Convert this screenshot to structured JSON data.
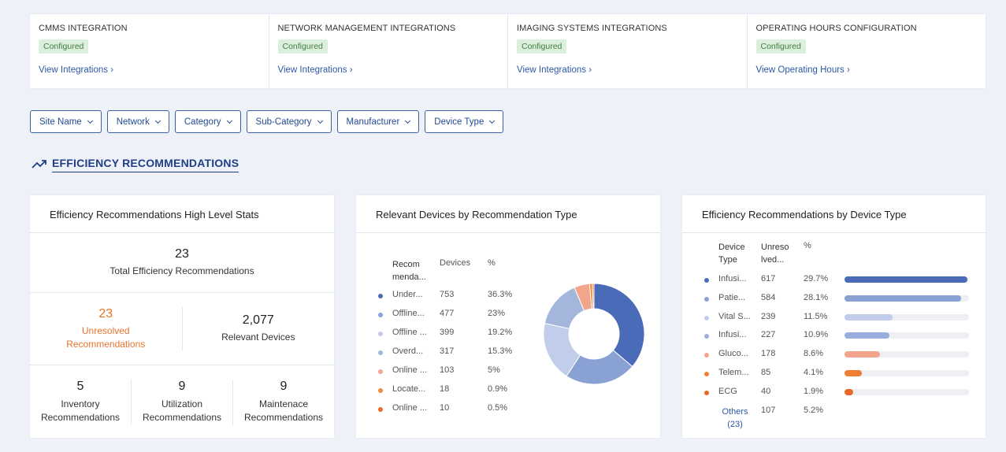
{
  "integrations": [
    {
      "title": "CMMS INTEGRATION",
      "status": "Configured",
      "link": "View Integrations ›"
    },
    {
      "title": "NETWORK MANAGEMENT INTEGRATIONS",
      "status": "Configured",
      "link": "View Integrations ›"
    },
    {
      "title": "IMAGING SYSTEMS INTEGRATIONS",
      "status": "Configured",
      "link": "View Integrations ›"
    },
    {
      "title": "OPERATING HOURS CONFIGURATION",
      "status": "Configured",
      "link": "View Operating Hours ›"
    }
  ],
  "filters": [
    "Site Name",
    "Network",
    "Category",
    "Sub-Category",
    "Manufacturer",
    "Device Type"
  ],
  "section": {
    "title": "EFFICIENCY RECOMMENDATIONS",
    "icon": "trending-up-icon"
  },
  "stats_card": {
    "title": "Efficiency Recommendations High Level Stats",
    "total_value": "23",
    "total_label": "Total Efficiency Recommendations",
    "unresolved_value": "23",
    "unresolved_label_1": "Unresolved",
    "unresolved_label_2": "Recommendations",
    "devices_value": "2,077",
    "devices_label": "Relevant Devices",
    "inventory_value": "5",
    "inventory_label_1": "Inventory",
    "inventory_label_2": "Recommendations",
    "utilization_value": "9",
    "utilization_label_1": "Utilization",
    "utilization_label_2": "Recommendations",
    "maintenance_value": "9",
    "maintenance_label_1": "Maintenace",
    "maintenance_label_2": "Recommendations"
  },
  "rec_card": {
    "title": "Relevant Devices by Recommendation Type",
    "headers": {
      "rec_1": "Recom",
      "rec_2": "menda...",
      "devices": "Devices",
      "pct": "%"
    },
    "rows": [
      {
        "label": "Under...",
        "devices": "753",
        "pct": "36.3%",
        "color": "#4a6cb8",
        "value": 36.3
      },
      {
        "label": "Offline...",
        "devices": "477",
        "pct": "23%",
        "color": "#8aa1d4",
        "value": 23
      },
      {
        "label": "Offline ...",
        "devices": "399",
        "pct": "19.2%",
        "color": "#c1cdea",
        "value": 19.2
      },
      {
        "label": "Overd...",
        "devices": "317",
        "pct": "15.3%",
        "color": "#a5b6dd",
        "value": 15.3
      },
      {
        "label": "Online ...",
        "devices": "103",
        "pct": "5%",
        "color": "#f0a58c",
        "value": 5
      },
      {
        "label": "Locate...",
        "devices": "18",
        "pct": "0.9%",
        "color": "#ee8a3a",
        "value": 0.9
      },
      {
        "label": "Online ...",
        "devices": "10",
        "pct": "0.5%",
        "color": "#e56a28",
        "value": 0.5
      }
    ]
  },
  "device_card": {
    "title": "Efficiency Recommendations by Device Type",
    "headers": {
      "type_1": "Device",
      "type_2": "Type",
      "unres_1": "Unreso",
      "unres_2": "lved...",
      "pct": "%"
    },
    "rows": [
      {
        "label": "Infusi...",
        "count": "617",
        "pct": "29.7%",
        "color": "#4a6cb8",
        "value": 29.7
      },
      {
        "label": "Patie...",
        "count": "584",
        "pct": "28.1%",
        "color": "#8aa1d4",
        "value": 28.1
      },
      {
        "label": "Vital S...",
        "count": "239",
        "pct": "11.5%",
        "color": "#c1cdea",
        "value": 11.5
      },
      {
        "label": "Infusi...",
        "count": "227",
        "pct": "10.9%",
        "color": "#9aaede",
        "value": 10.9
      },
      {
        "label": "Gluco...",
        "count": "178",
        "pct": "8.6%",
        "color": "#f0a58c",
        "value": 8.6
      },
      {
        "label": "Telem...",
        "count": "85",
        "pct": "4.1%",
        "color": "#ee7e33",
        "value": 4.1
      },
      {
        "label": "ECG",
        "count": "40",
        "pct": "1.9%",
        "color": "#e56a28",
        "value": 1.9
      }
    ],
    "others_1": "Others",
    "others_2": "(23)",
    "others_count": "107",
    "others_pct": "5.2%"
  }
}
